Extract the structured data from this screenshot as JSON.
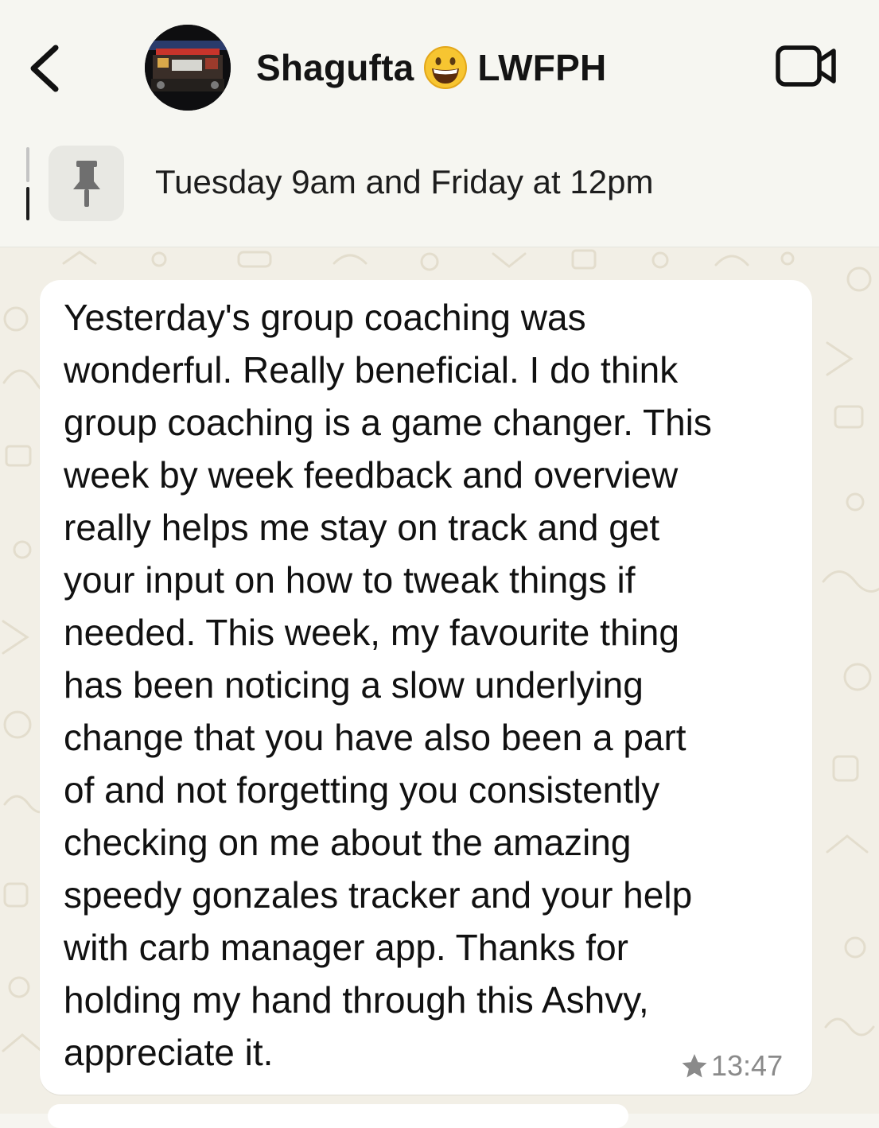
{
  "header": {
    "contact_name": "Shagufta",
    "contact_suffix": "LWFPH",
    "emoji": "grinning-face-emoji",
    "back_icon": "chevron-left-icon",
    "video_icon": "video-camera-icon"
  },
  "pinned": {
    "icon": "pin-icon",
    "text": "Tuesday 9am and Friday at 12pm"
  },
  "message": {
    "text": "Yesterday's group coaching was\nwonderful. Really beneficial. I do think\ngroup coaching is a game changer. This\nweek by week feedback and overview\nreally helps me stay on track and get\nyour input on how to tweak things if\nneeded. This week, my favourite thing\nhas been noticing a slow underlying\nchange that you have also been a part\nof and not forgetting you consistently\nchecking on me about the amazing\nspeedy gonzales tracker and your help\nwith carb manager app. Thanks for\nholding my hand through this Ashvy,\nappreciate it.",
    "starred_icon": "star-icon",
    "time": "13:47"
  },
  "colors": {
    "header_bg": "#f6f6f1",
    "chat_bg": "#f2efe6",
    "bubble_bg": "#ffffff",
    "text": "#111111",
    "meta": "#8a8a8a"
  }
}
